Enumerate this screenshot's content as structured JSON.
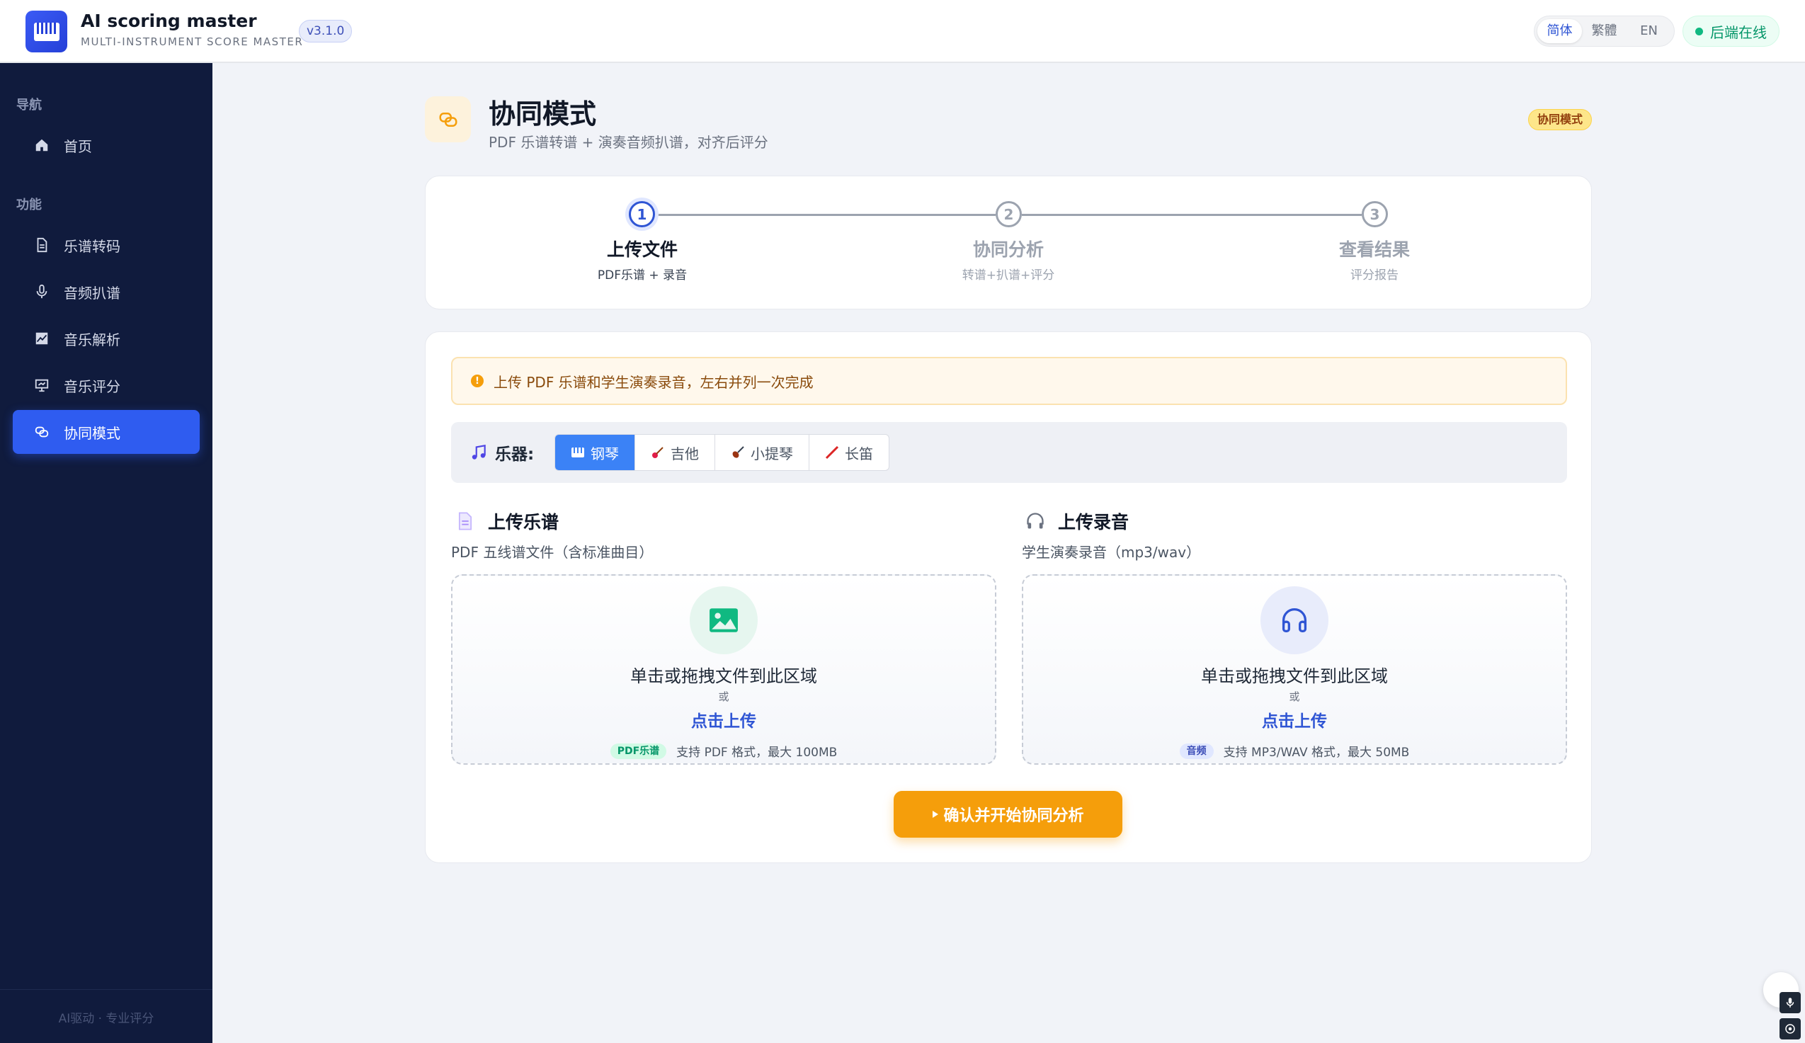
{
  "header": {
    "app_title": "AI scoring master",
    "app_subtitle": "MULTI-INSTRUMENT SCORE MASTER",
    "version": "v3.1.0",
    "languages": [
      "简体",
      "繁體",
      "EN"
    ],
    "active_language": "简体",
    "backend_status": "后端在线"
  },
  "sidebar": {
    "section_nav": "导航",
    "section_features": "功能",
    "items": [
      {
        "label": "首页",
        "icon": "home-icon"
      },
      {
        "label": "乐谱转码",
        "icon": "document-icon"
      },
      {
        "label": "音频扒谱",
        "icon": "microphone-icon"
      },
      {
        "label": "音乐解析",
        "icon": "chart-icon"
      },
      {
        "label": "音乐评分",
        "icon": "presentation-icon"
      },
      {
        "label": "协同模式",
        "icon": "link-icon"
      }
    ],
    "active_item": "协同模式",
    "footer": "AI驱动 · 专业评分"
  },
  "page": {
    "title": "协同模式",
    "subtitle": "PDF 乐谱转谱 + 演奏音频扒谱，对齐后评分",
    "badge": "协同模式"
  },
  "steps": [
    {
      "number": "1",
      "label": "上传文件",
      "sub": "PDF乐谱 + 录音",
      "state": "active"
    },
    {
      "number": "2",
      "label": "协同分析",
      "sub": "转谱+扒谱+评分",
      "state": "pending"
    },
    {
      "number": "3",
      "label": "查看结果",
      "sub": "评分报告",
      "state": "pending"
    }
  ],
  "main": {
    "alert": "上传 PDF 乐谱和学生演奏录音，左右并列一次完成",
    "instrument_label": "乐器:",
    "instruments": [
      "钢琴",
      "吉他",
      "小提琴",
      "长笛"
    ],
    "selected_instrument": "钢琴",
    "score_upload": {
      "title": "上传乐谱",
      "subtitle": "PDF 五线谱文件（含标准曲目）",
      "drop_text": "单击或拖拽文件到此区域",
      "or_text": "或",
      "link_text": "点击上传",
      "tag": "PDF乐谱",
      "hint": "支持 PDF 格式，最大 100MB"
    },
    "audio_upload": {
      "title": "上传录音",
      "subtitle": "学生演奏录音（mp3/wav）",
      "drop_text": "单击或拖拽文件到此区域",
      "or_text": "或",
      "link_text": "点击上传",
      "tag": "音频",
      "hint": "支持 MP3/WAV 格式，最大 50MB"
    },
    "confirm_button": "确认并开始协同分析"
  },
  "colors": {
    "accent": "#2f5cf0",
    "sidebar_bg": "#101b3d",
    "warning": "#f59e0b",
    "success": "#10b981"
  }
}
